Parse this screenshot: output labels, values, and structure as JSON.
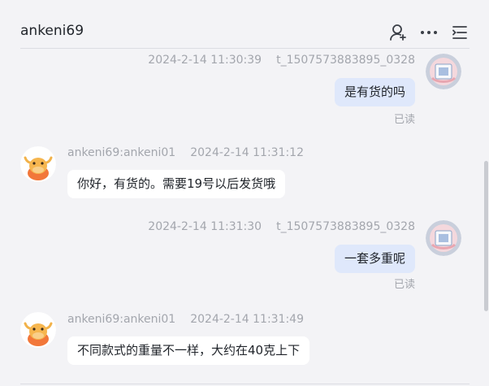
{
  "header": {
    "title": "ankeni69",
    "icons": [
      "add-user-icon",
      "more-icon",
      "list-icon"
    ]
  },
  "messages": [
    {
      "direction": "outgoing",
      "timestamp": "2024-2-14 11:30:39",
      "sender": "t_1507573883895_0328",
      "text": "是有货的吗",
      "status": "已读"
    },
    {
      "direction": "incoming",
      "sender": "ankeni69:ankeni01",
      "timestamp": "2024-2-14 11:31:12",
      "text": "你好，有货的。需要19号以后发货哦"
    },
    {
      "direction": "outgoing",
      "timestamp": "2024-2-14 11:31:30",
      "sender": "t_1507573883895_0328",
      "text": "一套多重呢",
      "status": "已读"
    },
    {
      "direction": "incoming",
      "sender": "ankeni69:ankeni01",
      "timestamp": "2024-2-14 11:31:49",
      "text": "不同款式的重量不一样，大约在40克上下"
    }
  ],
  "colors": {
    "background": "#f3f3f6",
    "outgoing_bubble": "#dfe8fb",
    "incoming_bubble": "#ffffff",
    "meta_text": "#a3a6ad"
  }
}
